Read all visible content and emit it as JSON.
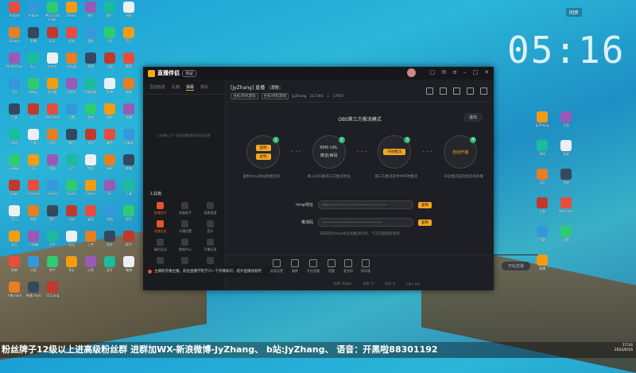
{
  "desktop": {
    "clock": "05:16",
    "tray_label": "同步",
    "taskbar_time": "17:16",
    "taskbar_date": "2022/6/16",
    "left_icons": [
      "Adobe",
      "Adobe",
      "Microsoft Edge",
      "Steam",
      "图片",
      "图片",
      "拼图",
      "Google",
      "直播",
      "Epic",
      "网易",
      "酷狗",
      "QQ",
      "音乐",
      "Photoshop",
      "办公",
      "文件夹",
      "浏览器",
      "视频",
      "压缩",
      "截图",
      "QQ",
      "网易云",
      "此电脑",
      "回收站",
      "控制面板",
      "剪辑",
      "录屏",
      "工具",
      "学习",
      "WeGame",
      "设置",
      "游戏",
      "图库",
      "直播",
      "OBS",
      "下载",
      "网盘",
      "微信",
      "文档",
      "邮件",
      "记事本",
      "计算器",
      "日历",
      "相册",
      "天气",
      "地图",
      "新闻",
      "邮箱",
      "Edge",
      "Chrome",
      "Firefox",
      "Opera",
      "Safari",
      "IE",
      "下载",
      "音乐",
      "视频",
      "图片",
      "文档",
      "桌面",
      "网络",
      "程序",
      "安全",
      "工具箱",
      "文件",
      "导出",
      "上传",
      "同步",
      "助手",
      "剪映",
      "抖音",
      "快手",
      "B站",
      "斗鱼",
      "虎牙",
      "微博",
      "大象.mp4",
      "新建.mp4",
      "111.png"
    ],
    "right_icons": [
      "JyZhang",
      "斗鱼",
      "OBS",
      "录屏",
      "QQ",
      "游戏",
      "工具",
      "WeGame",
      "下载",
      "设置",
      "直播"
    ],
    "banner": "粉丝牌子12级以上进高级粉丝群  进群加WX-新浪微博-JyZhang、  b站:JyZhang、  语音：开黑啦88301192"
  },
  "app": {
    "name": "直播伴侣",
    "version": "测试",
    "left_tabs": [
      "互动信息",
      "礼物",
      "弹幕",
      "观众"
    ],
    "empty_message": "1分钟以下 在线观看者的开启同步",
    "tools_title": "工具箱",
    "tools": [
      {
        "label": "直播助手",
        "hot": true
      },
      {
        "label": "房管助手",
        "hot": false
      },
      {
        "label": "场景管理",
        "hot": false
      },
      {
        "label": "直播连麦",
        "hot": true
      },
      {
        "label": "开播设置",
        "hot": false
      },
      {
        "label": "音乐",
        "hot": false
      },
      {
        "label": "福利活动",
        "hot": false
      },
      {
        "label": "数据中心",
        "hot": false
      },
      {
        "label": "开播记录",
        "hot": false
      },
      {
        "label": "更多",
        "hot": false
      },
      {
        "label": "弹幕",
        "hot": false
      },
      {
        "label": "设置",
        "hot": false
      }
    ],
    "notice": "主播新开播主播，前往直播学院学习一下开播知识，提升直播技能吧",
    "header": {
      "title": "[JyZhang] 直播",
      "tag": "直播",
      "category_1": "主机/单机游戏",
      "category_2": "主机/单机游戏",
      "user": "JyZhang",
      "room_id": "217346",
      "popularity": "17057"
    },
    "obs": {
      "title": "OBS第三方推流模式",
      "exit": "退出",
      "steps": [
        {
          "num": "1",
          "lines": [
            "复制",
            "复制"
          ],
          "desc": "复制rtmp地址和推流码"
        },
        {
          "num": "2",
          "lines": [
            "RMS URL",
            "推流/串码"
          ],
          "desc": "填入OBS推流三方推流地址"
        },
        {
          "num": "3",
          "lines": [
            "开始推流"
          ],
          "desc": "第三方推流软件中开始推流"
        },
        {
          "num": "4",
          "lines": [
            "自动开播"
          ],
          "desc": "开启推流成功后自动开播"
        }
      ],
      "rtmp_label": "rtmp地址",
      "rtmp_value": "rtmp://•••••••••••••••••••••••••••••",
      "key_label": "推流码",
      "key_value": "••••••••••••••••••••••••••••••••",
      "copy_label": "复制",
      "hint": "未获取到rtmp地址和推流码时，下次页面重新复制"
    },
    "bottom_tools": [
      "画面设置",
      "美颜",
      "开启直播",
      "提醒",
      "麦克风",
      "扬声器"
    ],
    "start_button": "开始直播",
    "status": [
      "码率: 0kbps",
      "帧率: 0",
      "丢帧: 0",
      "CPU: 0%"
    ]
  }
}
